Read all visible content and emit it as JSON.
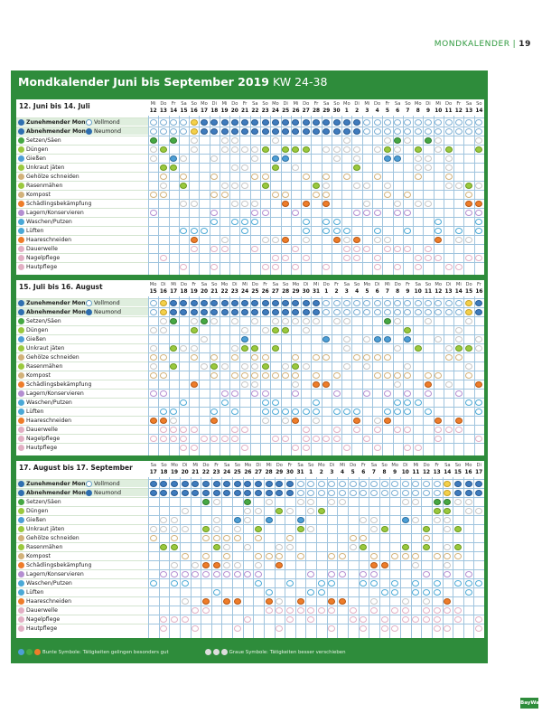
{
  "header": {
    "title": "MONDKALENDER",
    "page": "19"
  },
  "main_title": {
    "text": "Mondkalender Juni bis September 2019",
    "kw": "KW 24-38"
  },
  "moon_labels": {
    "waxing": "Zunehmender Mond",
    "full": "Vollmond",
    "waning": "Abnehmender Mond",
    "new": "Neumond"
  },
  "activities": [
    "Setzen/Säen",
    "Düngen",
    "Gießen",
    "Unkraut jäten",
    "Gehölze schneiden",
    "Rasenmähen",
    "Kompost",
    "Schädlingsbekämpfung",
    "Lagern/Konservieren",
    "Waschen/Putzen",
    "Lüften",
    "Haareschneiden",
    "Dauerwelle",
    "Nagelpflege",
    "Hautpflege"
  ],
  "colors": {
    "frame": "#2e8c3b",
    "green": "#46a843",
    "orange": "#ee7d2a",
    "blue": "#4d9fd6"
  },
  "sections": [
    {
      "title": "12. Juni bis 14. Juli",
      "days": [
        "Mi",
        "Do",
        "Fr",
        "Sa",
        "So",
        "Mo",
        "Di",
        "Mi",
        "Do",
        "Fr",
        "Sa",
        "So",
        "Mo",
        "Di",
        "Mi",
        "Do",
        "Fr",
        "Sa",
        "So",
        "Mo",
        "Di",
        "Mi",
        "Do",
        "Fr",
        "Sa",
        "So",
        "Mo",
        "Di",
        "Mi",
        "Do",
        "Fr",
        "Sa",
        "So"
      ],
      "dates": [
        "12",
        "13",
        "14",
        "15",
        "16",
        "17",
        "18",
        "19",
        "20",
        "21",
        "22",
        "23",
        "24",
        "25",
        "26",
        "27",
        "28",
        "29",
        "30",
        "1",
        "2",
        "3",
        "4",
        "5",
        "6",
        "7",
        "8",
        "9",
        "10",
        "11",
        "12",
        "13",
        "14"
      ],
      "moon": [
        "w",
        "w",
        "w",
        "w",
        "y",
        "c",
        "c",
        "c",
        "c",
        "c",
        "c",
        "c",
        "c",
        "c",
        "c",
        "c",
        "c",
        "c",
        "c",
        "c",
        "b",
        "w",
        "w",
        "w",
        "w",
        "w",
        "w",
        "w",
        "w",
        "w",
        "w",
        "w",
        "w"
      ]
    },
    {
      "title": "15. Juli bis 16. August",
      "days": [
        "Mo",
        "Di",
        "Mi",
        "Do",
        "Fr",
        "Sa",
        "So",
        "Mo",
        "Di",
        "Mi",
        "Do",
        "Fr",
        "Sa",
        "So",
        "Mo",
        "Di",
        "Mi",
        "Do",
        "Fr",
        "Sa",
        "So",
        "Mo",
        "Di",
        "Mi",
        "Do",
        "Fr",
        "Sa",
        "So",
        "Mo",
        "Di",
        "Mi",
        "Do",
        "Fr"
      ],
      "dates": [
        "15",
        "16",
        "17",
        "18",
        "19",
        "20",
        "21",
        "22",
        "23",
        "24",
        "25",
        "26",
        "27",
        "28",
        "29",
        "30",
        "31",
        "1",
        "2",
        "3",
        "4",
        "5",
        "6",
        "7",
        "8",
        "9",
        "10",
        "11",
        "12",
        "13",
        "14",
        "15",
        "16"
      ],
      "moon": [
        "w",
        "y",
        "c",
        "c",
        "c",
        "c",
        "c",
        "c",
        "c",
        "c",
        "c",
        "c",
        "c",
        "c",
        "c",
        "c",
        "b",
        "w",
        "w",
        "w",
        "w",
        "w",
        "w",
        "w",
        "w",
        "w",
        "w",
        "w",
        "w",
        "w",
        "w",
        "y",
        "c"
      ]
    },
    {
      "title": "17. August bis 17. September",
      "days": [
        "Sa",
        "So",
        "Mo",
        "Di",
        "Mi",
        "Do",
        "Fr",
        "Sa",
        "So",
        "Mo",
        "Di",
        "Mi",
        "Do",
        "Fr",
        "Sa",
        "So",
        "Mo",
        "Di",
        "Mi",
        "Do",
        "Fr",
        "Sa",
        "So",
        "Mo",
        "Di",
        "Mi",
        "Do",
        "Fr",
        "Sa",
        "So",
        "Mo",
        "Di"
      ],
      "dates": [
        "17",
        "18",
        "19",
        "20",
        "21",
        "22",
        "23",
        "24",
        "25",
        "26",
        "27",
        "28",
        "29",
        "30",
        "31",
        "1",
        "2",
        "3",
        "4",
        "5",
        "6",
        "7",
        "8",
        "9",
        "10",
        "11",
        "12",
        "13",
        "14",
        "15",
        "16",
        "17"
      ],
      "moon": [
        "c",
        "c",
        "c",
        "c",
        "c",
        "c",
        "c",
        "c",
        "c",
        "c",
        "c",
        "c",
        "c",
        "b",
        "w",
        "w",
        "w",
        "w",
        "w",
        "w",
        "w",
        "w",
        "w",
        "w",
        "w",
        "w",
        "w",
        "w",
        "y",
        "c",
        "c",
        "c"
      ]
    }
  ],
  "footer": {
    "bunt": "Bunte Symbole: Tätigkeiten gelingen besonders gut",
    "grau": "Graue Symbole: Tätigkeiten besser verschieben"
  },
  "brand": "BayWa"
}
